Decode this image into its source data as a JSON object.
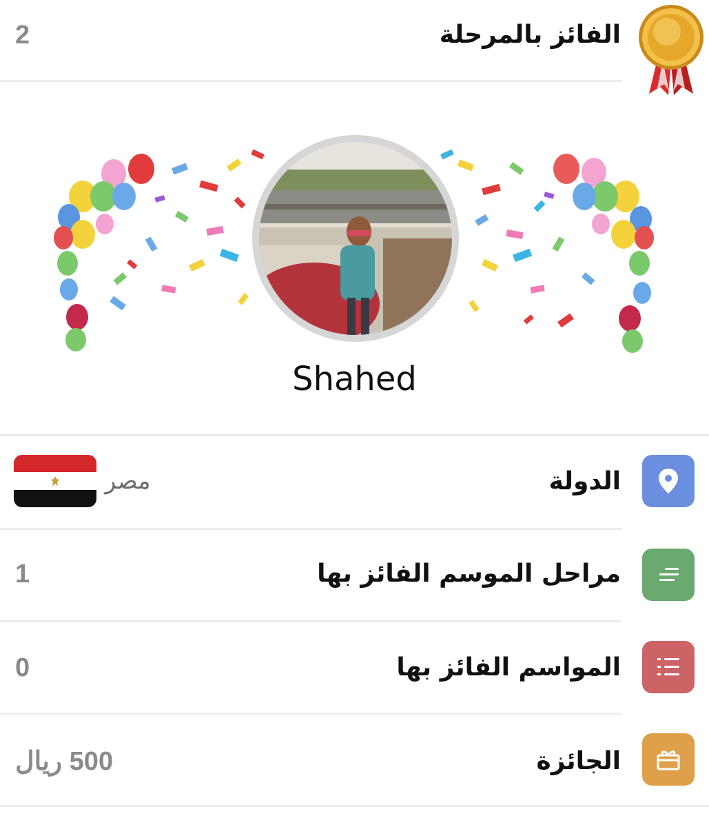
{
  "top_row": {
    "label": "الفائز بالمرحلة",
    "value": "2",
    "medal_icon": "gold-medal-icon"
  },
  "profile": {
    "username": "Shahed",
    "avatar_icon": "profile-photo",
    "banner_icon": "confetti-balloons"
  },
  "stats": [
    {
      "label": "الدولة",
      "value": "مصر",
      "icon": "location-pin-icon",
      "color": "#6b8fdf",
      "flag": "egypt-flag"
    },
    {
      "label": "مراحل الموسم الفائز بها",
      "value": "1",
      "icon": "lines-icon",
      "color": "#6aaa6f"
    },
    {
      "label": "المواسم الفائز بها",
      "value": "0",
      "icon": "numbered-list-icon",
      "color": "#cc6465"
    },
    {
      "label": "الجائزة",
      "value": "500 ريال",
      "icon": "gift-icon",
      "color": "#e0a04a"
    }
  ]
}
